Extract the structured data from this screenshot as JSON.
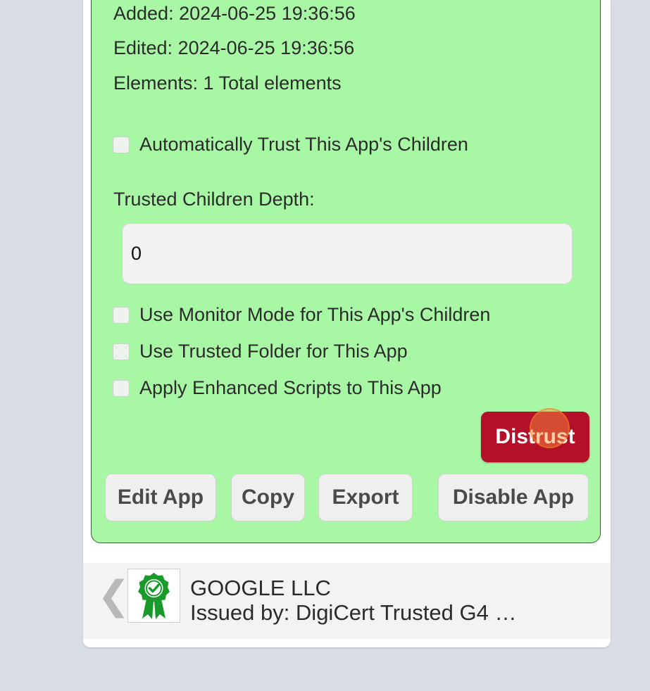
{
  "app_details": {
    "added": "Added: 2024-06-25 19:36:56",
    "edited": "Edited: 2024-06-25 19:36:56",
    "elements": "Elements: 1 Total elements"
  },
  "options": {
    "auto_trust_children": {
      "label": "Automatically Trust This App's Children",
      "checked": false
    },
    "trusted_children_depth_label": "Trusted Children Depth:",
    "trusted_children_depth_value": "0",
    "monitor_mode_children": {
      "label": "Use Monitor Mode for This App's Children",
      "checked": false
    },
    "trusted_folder": {
      "label": "Use Trusted Folder for This App",
      "checked": false
    },
    "enhanced_scripts": {
      "label": "Apply Enhanced Scripts to This App",
      "checked": false
    }
  },
  "buttons": {
    "distrust": "Distrust",
    "edit_app": "Edit App",
    "copy": "Copy",
    "export": "Export",
    "disable_app": "Disable App"
  },
  "certificate": {
    "icon": "certificate-ribbon-icon",
    "title": "GOOGLE LLC",
    "issued_by": "Issued by: DigiCert Trusted G4 …"
  },
  "colors": {
    "panel_bg": "#a8f7a5",
    "distrust_bg": "#b5102a",
    "cert_icon": "#1a9a2a",
    "page_bg": "#d8dde3"
  }
}
